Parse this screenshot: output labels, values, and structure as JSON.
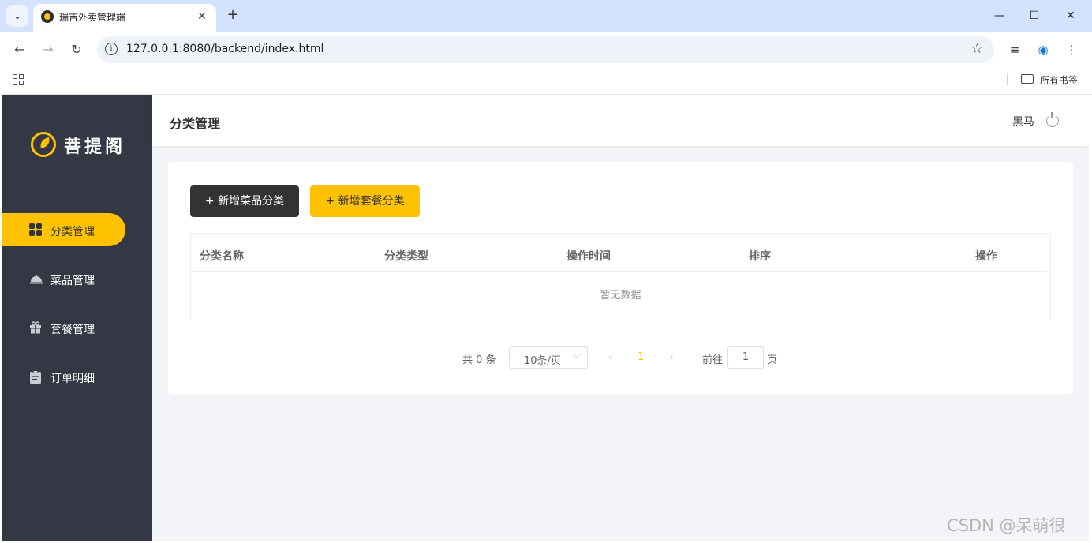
{
  "browser": {
    "tab_title": "瑞吉外卖管理端",
    "tab_close": "✕",
    "new_tab": "+",
    "url": "127.0.0.1:8080/backend/index.html",
    "bookmarks_folder": "所有书签",
    "icons": [
      "tab-list-icon",
      "close-icon",
      "minimize-icon",
      "maximize-icon",
      "back-icon",
      "forward-icon",
      "reload-icon",
      "info-icon",
      "star-icon",
      "media-icon",
      "profile-icon",
      "more-icon",
      "apps-icon",
      "folder-icon"
    ]
  },
  "sidebar": {
    "logo_text": "菩提阁",
    "items": [
      {
        "label": "分类管理",
        "icon": "grid-icon",
        "active": true
      },
      {
        "label": "菜品管理",
        "icon": "dish-icon",
        "active": false
      },
      {
        "label": "套餐管理",
        "icon": "gift-icon",
        "active": false
      },
      {
        "label": "订单明细",
        "icon": "clipboard-icon",
        "active": false
      }
    ]
  },
  "header": {
    "title": "分类管理",
    "user": "黑马",
    "logout_icon": "power-icon"
  },
  "actions": {
    "add_dish_category": "+ 新增菜品分类",
    "add_combo_category": "+ 新增套餐分类"
  },
  "table": {
    "columns": [
      "分类名称",
      "分类类型",
      "操作时间",
      "排序",
      "操作"
    ],
    "rows": [],
    "empty_text": "暂无数据"
  },
  "pagination": {
    "total_text": "共 0 条",
    "page_size": "10条/页",
    "current_page": "1",
    "goto_label": "前往",
    "goto_value": "1",
    "page_suffix": "页"
  },
  "watermark": "CSDN @呆萌很",
  "colors": {
    "accent": "#ffc200",
    "sidebar_bg": "#343744",
    "dark_button": "#333333",
    "content_bg": "#f3f4f7"
  }
}
